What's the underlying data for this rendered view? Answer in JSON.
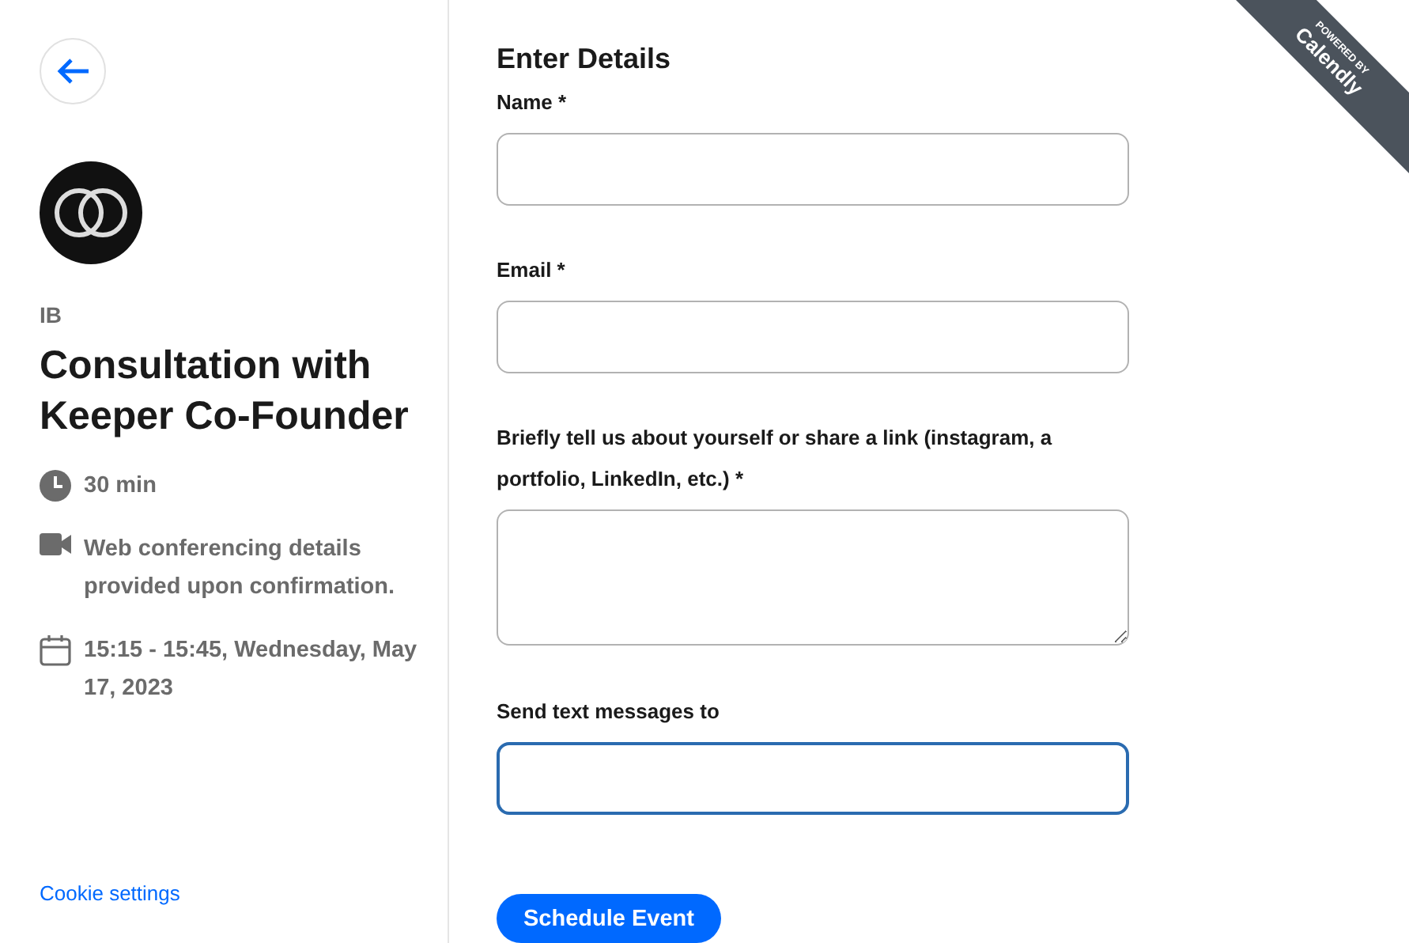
{
  "sidebar": {
    "organizer": "IB",
    "title": "Consultation with Keeper Co-Founder",
    "details": [
      {
        "kind": "clock",
        "text": "30 min"
      },
      {
        "kind": "video",
        "text": "Web conferencing details provided upon confirmation."
      },
      {
        "kind": "calendar",
        "text": "15:15 - 15:45, Wednesday, May 17, 2023"
      }
    ],
    "cookie_link": "Cookie settings"
  },
  "form": {
    "heading": "Enter Details",
    "fields": [
      {
        "kind": "text",
        "label": "Name *",
        "focused": false
      },
      {
        "kind": "text",
        "label": "Email *",
        "focused": false
      },
      {
        "kind": "textarea",
        "label": "Briefly tell us about yourself or share a link (instagram, a portfolio, LinkedIn, etc.) *",
        "focused": false
      },
      {
        "kind": "text",
        "label": "Send text messages to",
        "focused": true
      }
    ],
    "submit": "Schedule Event"
  },
  "ribbon": {
    "small": "POWERED BY",
    "brand": "Calendly"
  }
}
